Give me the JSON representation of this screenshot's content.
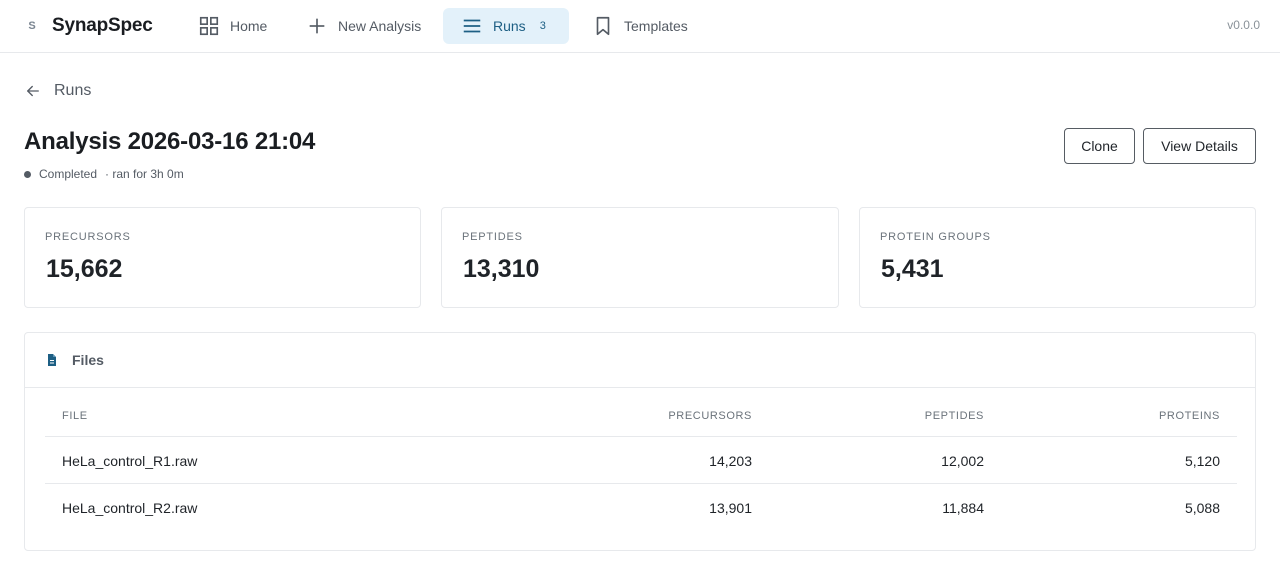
{
  "app": {
    "brand_mark": "S",
    "brand_name": "SynapSpec",
    "version": "v0.0.0"
  },
  "nav": {
    "home": "Home",
    "new_analysis": "New Analysis",
    "runs": "Runs",
    "runs_count": "3",
    "templates": "Templates"
  },
  "back_link": "Runs",
  "header": {
    "title": "Analysis 2026-03-16 21:04",
    "status": "Completed",
    "duration": "· ran for 3h 0m",
    "clone_label": "Clone",
    "view_details_label": "View Details"
  },
  "stats": [
    {
      "label": "Precursors",
      "value": "15,662"
    },
    {
      "label": "Peptides",
      "value": "13,310"
    },
    {
      "label": "Protein Groups",
      "value": "5,431"
    }
  ],
  "files": {
    "title": "Files",
    "columns": [
      "File",
      "Precursors",
      "Peptides",
      "Proteins"
    ],
    "rows": [
      {
        "file": "HeLa_control_R1.raw",
        "precursors": "14,203",
        "peptides": "12,002",
        "proteins": "5,120"
      },
      {
        "file": "HeLa_control_R2.raw",
        "precursors": "13,901",
        "peptides": "11,884",
        "proteins": "5,088"
      }
    ]
  },
  "colors": {
    "accent": "#1d5f84",
    "accent_bg": "#e3f1fa",
    "border": "#e7e9ec",
    "muted_text": "#6b737b"
  },
  "icons": {
    "home": "grid-icon",
    "new_analysis": "plus-icon",
    "runs": "list-icon",
    "templates": "bookmark-icon",
    "back": "arrow-left-icon",
    "files": "document-icon"
  }
}
